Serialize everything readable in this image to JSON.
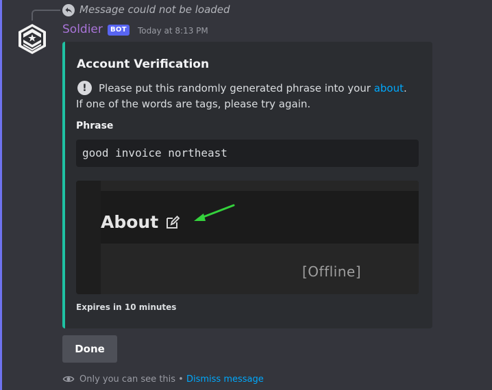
{
  "reply": {
    "text": "Message could not be loaded"
  },
  "author": {
    "name": "Soldier",
    "tag": "BOT",
    "timestamp": "Today at 8:13 PM"
  },
  "embed": {
    "accent_color": "#1fc1a2",
    "title": "Account Verification",
    "description_prefix": "Please put this randomly generated phrase into your ",
    "description_link": "about",
    "description_suffix": ".",
    "description_line2": "If one of the words are tags, please try again.",
    "field_name": "Phrase",
    "phrase": "good invoice northeast",
    "image": {
      "heading": "About",
      "status": "[Offline]"
    },
    "footer": "Expires in 10 minutes"
  },
  "done_button": {
    "label": "Done"
  },
  "ephemeral": {
    "text": "Only you can see this",
    "separator": " • ",
    "dismiss": "Dismiss message"
  },
  "icons": [
    "reply-arrow-icon",
    "avatar-chevron-star-icon",
    "info-exclamation-icon",
    "pencil-edit-icon",
    "eye-icon"
  ]
}
